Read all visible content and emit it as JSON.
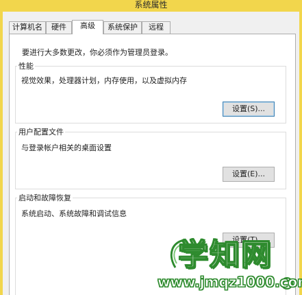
{
  "window": {
    "title": "系统属性"
  },
  "tabs": [
    {
      "label": "计算机名",
      "active": false
    },
    {
      "label": "硬件",
      "active": false
    },
    {
      "label": "高级",
      "active": true
    },
    {
      "label": "系统保护",
      "active": false
    },
    {
      "label": "远程",
      "active": false
    }
  ],
  "panel": {
    "intro": "要进行大多数更改，你必须作为管理员登录。",
    "performance": {
      "title": "性能",
      "desc": "视觉效果，处理器计划，内存使用，以及虚拟内存",
      "button": "设置(S)..."
    },
    "user_profiles": {
      "title": "用户配置文件",
      "desc": "与登录帐户相关的桌面设置",
      "button": "设置(E)..."
    },
    "startup_recovery": {
      "title": "启动和故障恢复",
      "desc": "系统启动、系统故障和调试信息",
      "button": "设置(T)..."
    }
  },
  "watermark": {
    "text": "学知网",
    "url": "www.jmqz1000.com"
  },
  "colors": {
    "accent": "#3c7fb1",
    "frame": "#f2d64c",
    "watermark": "#2e8b2e"
  }
}
